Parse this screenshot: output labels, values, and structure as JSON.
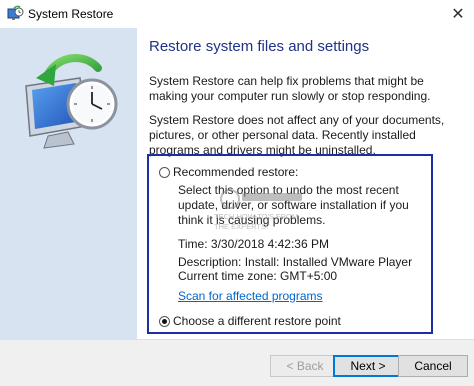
{
  "window": {
    "title": "System Restore",
    "close_glyph": "✕"
  },
  "main": {
    "heading": "Restore system files and settings",
    "paragraph1": "System Restore can help fix problems that might be making your computer run slowly or stop responding.",
    "paragraph2": "System Restore does not affect any of your documents, pictures, or other personal data. Recently installed programs and drivers might be uninstalled."
  },
  "options": {
    "recommended": {
      "label": "Recommended restore:",
      "selected": false,
      "description": "Select this option to undo the most recent update, driver, or software installation if you think it is causing problems.",
      "time": "Time: 3/30/2018 4:42:36 PM",
      "restore_description": "Description: Install: Installed VMware Player",
      "timezone": "Current time zone: GMT+5:00",
      "scan_link": "Scan for affected programs"
    },
    "different": {
      "label": "Choose a different restore point",
      "selected": true
    }
  },
  "footer": {
    "back_label": "< Back",
    "next_label": "Next >",
    "cancel_label": "Cancel"
  },
  "watermark": {
    "text_line1": "TECH HOW-TO'S FROM",
    "text_line2": "THE EXPERTS!"
  },
  "colors": {
    "heading": "#1e3287",
    "sidebar": "#d8e3f2",
    "highlight_border": "#1c2ea1",
    "link": "#0066cc"
  }
}
